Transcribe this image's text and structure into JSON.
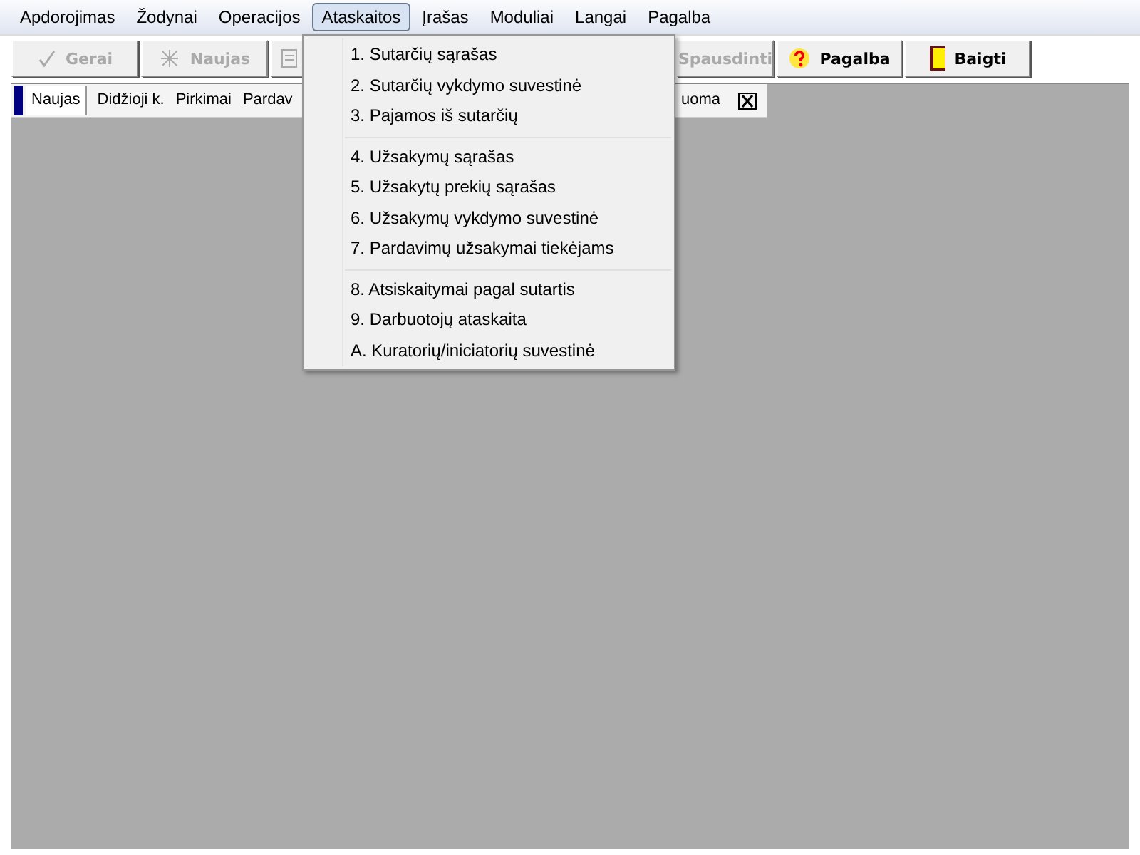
{
  "menu_bar": [
    {
      "label": "Apdorojimas",
      "selected": false
    },
    {
      "label": "Žodynai",
      "selected": false
    },
    {
      "label": "Operacijos",
      "selected": false
    },
    {
      "label": "Ataskaitos",
      "selected": true
    },
    {
      "label": "Įrašas",
      "selected": false
    },
    {
      "label": "Moduliai",
      "selected": false
    },
    {
      "label": "Langai",
      "selected": false
    },
    {
      "label": "Pagalba",
      "selected": false
    }
  ],
  "toolbar": [
    {
      "kind": "check",
      "label": "Gerai",
      "disabled": true
    },
    {
      "kind": "new",
      "label": "Naujas",
      "disabled": true
    },
    {
      "kind": "doc",
      "disabled": true
    },
    {
      "kind": "gap"
    },
    {
      "kind": "print",
      "label": "Spausdinti",
      "disabled": true
    },
    {
      "kind": "help",
      "label": "Pagalba",
      "disabled": false
    },
    {
      "kind": "exit",
      "label": "Baigti",
      "disabled": false
    }
  ],
  "window_tabs": {
    "left": [
      {
        "label": "Naujas",
        "selected": true
      },
      {
        "label": "Didžioji k.",
        "selected": false
      },
      {
        "label": "Pirkimai",
        "selected": false
      },
      {
        "label": "Pardav",
        "selected": false
      }
    ],
    "right": [
      {
        "label": "uoma",
        "selected": false
      }
    ]
  },
  "dropdown": [
    [
      "1. Sutarčių sąrašas",
      "2. Sutarčių vykdymo suvestinė",
      "3. Pajamos iš sutarčių"
    ],
    [
      "4. Užsakymų sąrašas",
      "5. Užsakytų prekių sąrašas",
      "6. Užsakymų vykdymo suvestinė",
      "7. Pardavimų užsakymai tiekėjams"
    ],
    [
      "8. Atsiskaitymai pagal sutartis",
      "9. Darbuotojų ataskaita",
      "A. Kuratorių/iniciatorių suvestinė"
    ]
  ]
}
